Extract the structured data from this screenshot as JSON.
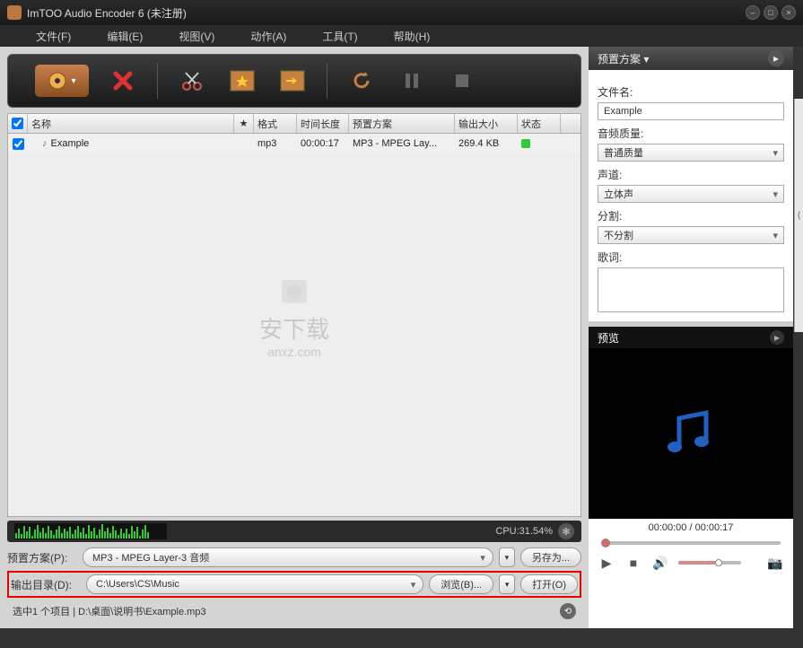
{
  "title": "ImTOO Audio Encoder 6 (未注册)",
  "menu": {
    "file": "文件(F)",
    "edit": "编辑(E)",
    "view": "视图(V)",
    "action": "动作(A)",
    "tools": "工具(T)",
    "help": "帮助(H)"
  },
  "list": {
    "headers": {
      "name": "名称",
      "star": "★",
      "fmt": "格式",
      "dur": "时间长度",
      "prof": "预置方案",
      "size": "输出大小",
      "stat": "状态"
    },
    "row": {
      "name": "Example",
      "fmt": "mp3",
      "dur": "00:00:17",
      "prof": "MP3 - MPEG Lay...",
      "size": "269.4 KB"
    }
  },
  "watermark": {
    "big": "安下载",
    "small": "anxz.com"
  },
  "cpu": "CPU:31.54%",
  "preset": {
    "label": "预置方案(P):",
    "value": "MP3 - MPEG Layer-3 音频",
    "saveas": "另存为..."
  },
  "output": {
    "label": "输出目录(D):",
    "value": "C:\\Users\\CS\\Music",
    "browse": "浏览(B)...",
    "open": "打开(O)"
  },
  "status": "选中1 个项目 | D:\\桌面\\说明书\\Example.mp3",
  "side": {
    "header": "预置方案",
    "filename_lbl": "文件名:",
    "filename": "Example",
    "quality_lbl": "音频质量:",
    "quality": "普通质量",
    "channel_lbl": "声道:",
    "channel": "立体声",
    "split_lbl": "分割:",
    "split": "不分割",
    "lyrics_lbl": "歌词:"
  },
  "preview": {
    "header": "预览",
    "time": "00:00:00 / 00:00:17"
  }
}
